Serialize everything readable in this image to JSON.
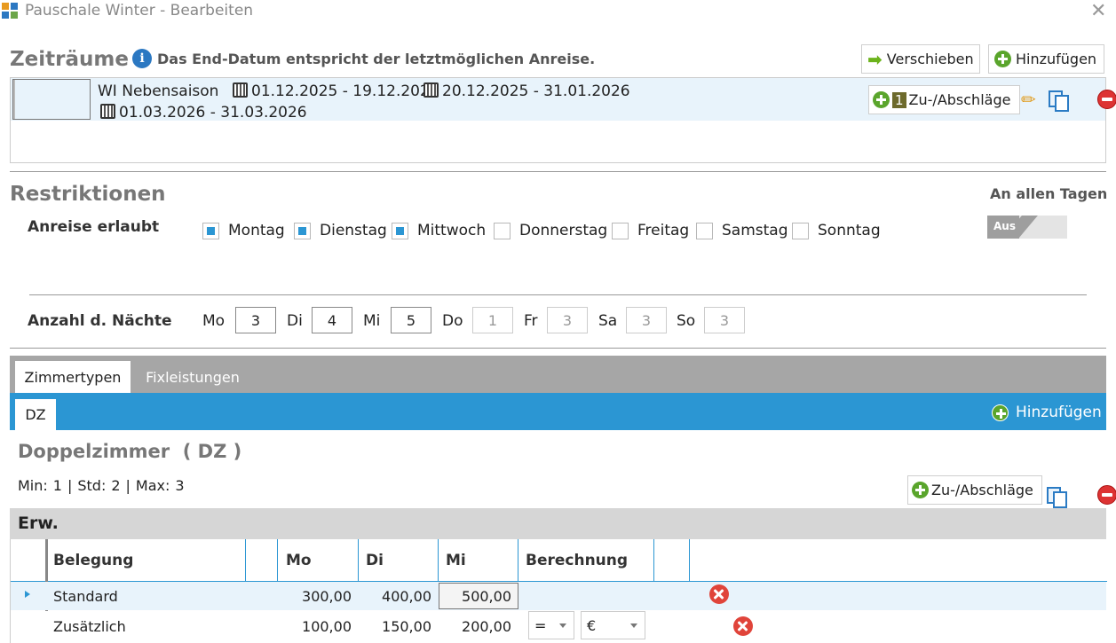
{
  "window": {
    "title": "Pauschale Winter - Bearbeiten"
  },
  "zeitraeume": {
    "title": "Zeiträume",
    "info": "Das End-Datum entspricht der letztmöglichen Anreise.",
    "move_label": "Verschieben",
    "add_label": "Hinzufügen",
    "row": {
      "name": "WI Nebensaison",
      "ranges": [
        "01.12.2025 - 19.12.2025",
        "20.12.2025 - 31.01.2026",
        "01.03.2026 - 31.03.2026"
      ],
      "count": "1",
      "surcharge_label": "Zu-/Abschläge"
    }
  },
  "restriktionen": {
    "title": "Restriktionen",
    "all_days_label": "An allen Tagen",
    "toggle_label": "Aus",
    "anreise_label": "Anreise erlaubt",
    "days": [
      {
        "label": "Montag",
        "checked": true
      },
      {
        "label": "Dienstag",
        "checked": true
      },
      {
        "label": "Mittwoch",
        "checked": true
      },
      {
        "label": "Donnerstag",
        "checked": false
      },
      {
        "label": "Freitag",
        "checked": false
      },
      {
        "label": "Samstag",
        "checked": false
      },
      {
        "label": "Sonntag",
        "checked": false
      }
    ],
    "naechte_label": "Anzahl d. Nächte",
    "nights": [
      {
        "day": "Mo",
        "value": "3",
        "enabled": true
      },
      {
        "day": "Di",
        "value": "4",
        "enabled": true
      },
      {
        "day": "Mi",
        "value": "5",
        "enabled": true
      },
      {
        "day": "Do",
        "value": "1",
        "enabled": false
      },
      {
        "day": "Fr",
        "value": "3",
        "enabled": false
      },
      {
        "day": "Sa",
        "value": "3",
        "enabled": false
      },
      {
        "day": "So",
        "value": "3",
        "enabled": false
      }
    ]
  },
  "tabs": {
    "items": [
      "Zimmertypen",
      "Fixleistungen"
    ],
    "active": "Zimmertypen"
  },
  "room_tabs": {
    "items": [
      "DZ"
    ],
    "add_label": "Hinzufügen"
  },
  "room": {
    "title": "Doppelzimmer  ( DZ )",
    "min_label": "Min:",
    "min": "1",
    "std_label": "Std:",
    "std": "2",
    "max_label": "Max:",
    "max": "3",
    "sep": "|",
    "surcharge_label": "Zu-/Abschläge",
    "group_label": "Erw."
  },
  "grid": {
    "headers": [
      "Belegung",
      "Mo",
      "Di",
      "Mi",
      "Berechnung"
    ],
    "rows": [
      {
        "label": "Standard",
        "mo": "300,00",
        "di": "400,00",
        "mi": "500,00",
        "op": "",
        "unit": ""
      },
      {
        "label": "Zusätzlich",
        "mo": "100,00",
        "di": "150,00",
        "mi": "200,00",
        "op": "=",
        "unit": "€"
      }
    ]
  },
  "colors": {
    "accent": "#2b96d3",
    "tabbar": "#a6a6a6",
    "row_selected": "#e8f3fb"
  }
}
